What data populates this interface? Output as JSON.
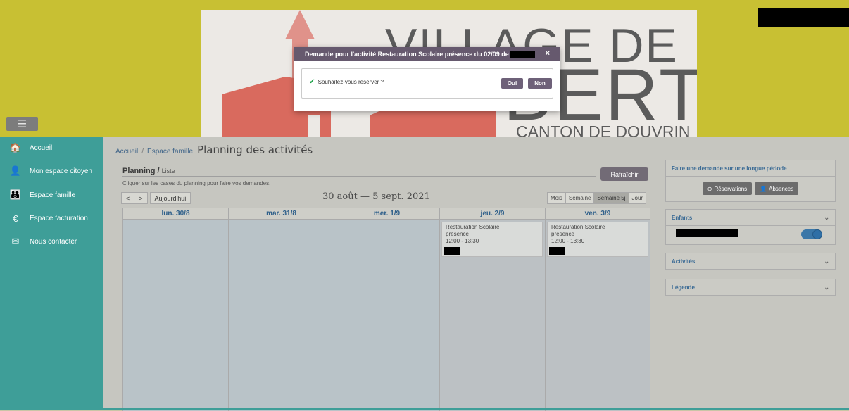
{
  "header": {
    "banner_line1": "VILLAGE DE",
    "banner_line2": "BERT",
    "banner_line3": "CANTON DE DOUVRIN",
    "menu_icon": "hamburger-icon"
  },
  "sidebar": {
    "items": [
      {
        "label": "Accueil",
        "icon": "home-icon",
        "glyph": "🏠"
      },
      {
        "label": "Mon espace citoyen",
        "icon": "user-icon",
        "glyph": "👤"
      },
      {
        "label": "Espace famille",
        "icon": "family-icon",
        "glyph": "👪"
      },
      {
        "label": "Espace facturation",
        "icon": "euro-icon",
        "glyph": "€"
      },
      {
        "label": "Nous contacter",
        "icon": "mail-icon",
        "glyph": "✉"
      }
    ]
  },
  "breadcrumb": {
    "home": "Accueil",
    "sep": "/",
    "section": "Espace famille",
    "title": "Planning des activités"
  },
  "planning": {
    "title": "Planning /",
    "subtitle": "Liste",
    "hint": "Cliquer sur les cases du planning pour faire vos demandes.",
    "refresh_label": "Rafraîchir",
    "prev_label": "<",
    "next_label": ">",
    "today_label": "Aujourd'hui",
    "range_title": "30 août — 5 sept. 2021",
    "views": [
      "Mois",
      "Semaine",
      "Semaine 5j",
      "Jour"
    ],
    "active_view": "Semaine 5j",
    "columns": [
      "lun. 30/8",
      "mar. 31/8",
      "mer. 1/9",
      "jeu. 2/9",
      "ven. 3/9"
    ],
    "events": [
      {
        "column": 3,
        "title": "Restauration Scolaire",
        "status": "présence",
        "time": "12:00 - 13:30"
      },
      {
        "column": 4,
        "title": "Restauration Scolaire",
        "status": "présence",
        "time": "12:00 - 13:30"
      }
    ]
  },
  "right_panel": {
    "long_period_title": "Faire une demande sur une longue période",
    "reservations_label": "Réservations",
    "absences_label": "Absences",
    "enfants_title": "Enfants",
    "activites_title": "Activités",
    "legende_title": "Légende"
  },
  "modal": {
    "title": "Demande pour l'activité Restauration Scolaire présence du 02/09 de",
    "close_label": "×",
    "question": "Souhaitez-vous réserver ?",
    "yes_label": "Oui",
    "no_label": "Non"
  },
  "colors": {
    "header": "#c8c033",
    "sidebar": "#3e9e98",
    "modal_header": "#66596e",
    "toggle": "#3b77a8"
  }
}
